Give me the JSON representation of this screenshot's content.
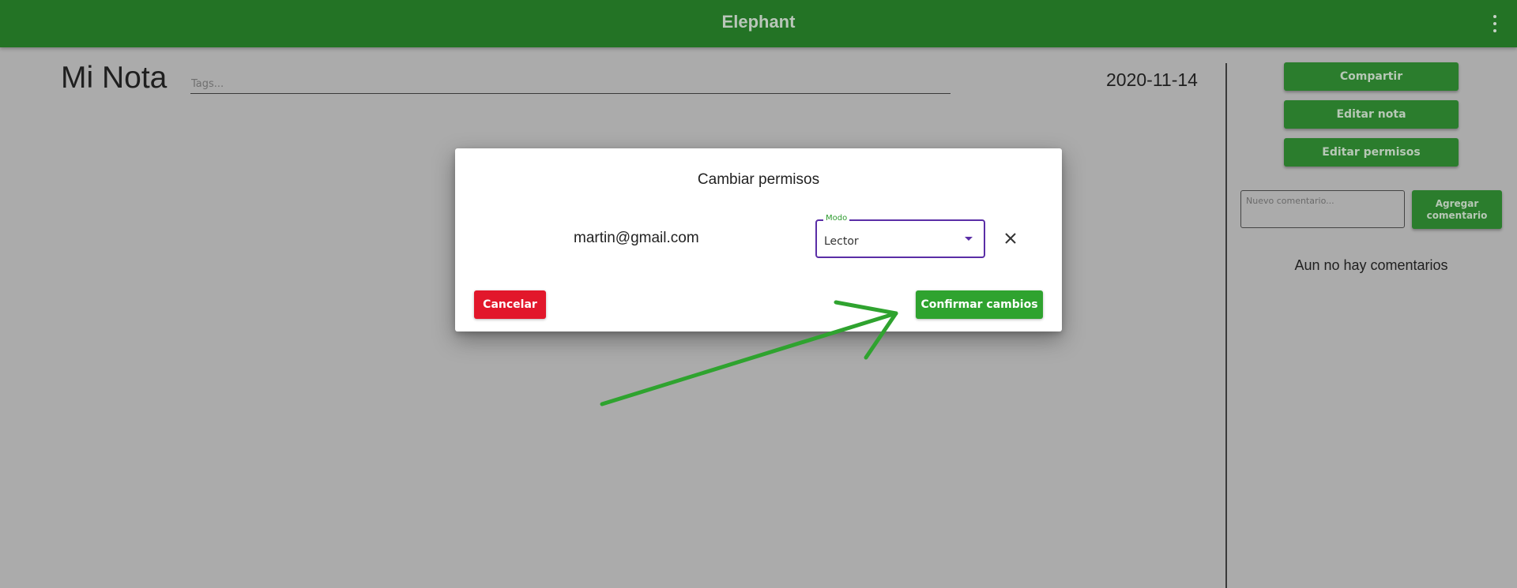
{
  "appbar": {
    "title": "Elephant",
    "menu_icon": "more-vert-icon",
    "color": "#237325"
  },
  "note": {
    "title": "Mi Nota",
    "tags_placeholder": "Tags...",
    "date": "2020-11-14"
  },
  "sidebar": {
    "share_label": "Compartir",
    "edit_note_label": "Editar nota",
    "edit_permissions_label": "Editar permisos",
    "comment_placeholder": "Nuevo comentario...",
    "add_comment_label": "Agregar comentario",
    "no_comments_text": "Aun no hay comentarios"
  },
  "modal": {
    "title": "Cambiar permisos",
    "email": "martin@gmail.com",
    "mode_label": "Modo",
    "mode_value": "Lector",
    "cancel_label": "Cancelar",
    "confirm_label": "Confirmar cambios",
    "cancel_color": "#e2172b",
    "confirm_color": "#2fa32f",
    "focus_color": "#5a2ea6"
  },
  "annotation": {
    "arrow_color": "#2fa32f",
    "arrow_icon": "arrow-annotation"
  }
}
